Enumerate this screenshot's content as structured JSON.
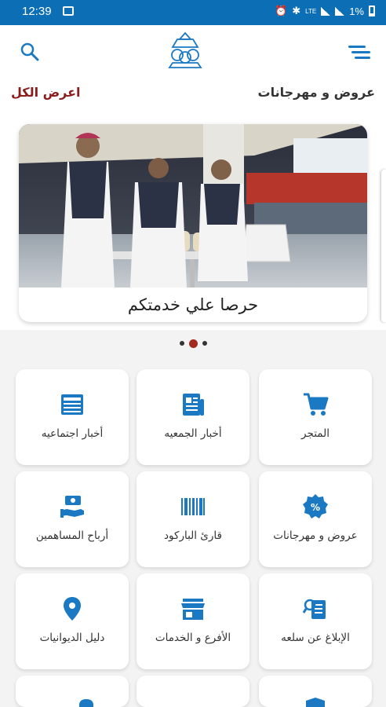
{
  "status_bar": {
    "time": "12:39",
    "battery": "1%",
    "network": "LTE"
  },
  "header": {
    "logo_icon": "organization-logo-icon"
  },
  "section": {
    "title": "عروض و مهرجانات",
    "view_all_label": "اعرض الكل"
  },
  "banner": {
    "caption": "حرصا علي خدمتكم",
    "slide_count": 3,
    "active_slide": 2
  },
  "grid": {
    "items": [
      {
        "label": "المتجر",
        "icon": "cart-icon"
      },
      {
        "label": "أخبار الجمعيه",
        "icon": "newspaper-icon"
      },
      {
        "label": "أخبار اجتماعيه",
        "icon": "article-icon"
      },
      {
        "label": "عروض و مهرجانات",
        "icon": "percent-badge-icon"
      },
      {
        "label": "قارئ الباركود",
        "icon": "barcode-icon"
      },
      {
        "label": "أرباح المساهمين",
        "icon": "cash-hand-icon"
      },
      {
        "label": "الإبلاغ عن سلعه",
        "icon": "report-item-icon"
      },
      {
        "label": "الأفرع و الخدمات",
        "icon": "storefront-icon"
      },
      {
        "label": "دليل الديوانيات",
        "icon": "location-pin-icon"
      }
    ]
  },
  "colors": {
    "primary": "#0c6fb5",
    "icon_blue": "#1b79c4",
    "accent_red": "#8b1c1c"
  }
}
